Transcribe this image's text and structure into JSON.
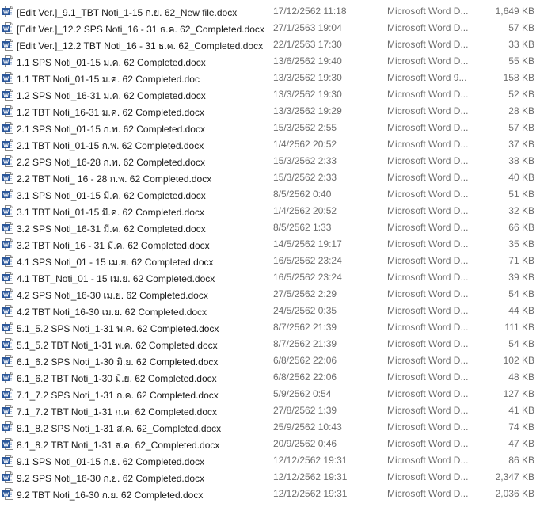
{
  "files": [
    {
      "name": "[Edit Ver.]_9.1_TBT Noti_1-15 ก.ย. 62_New file.docx",
      "date": "17/12/2562 11:18",
      "type": "Microsoft Word D...",
      "size": "1,649 KB",
      "icon": "word-document-icon"
    },
    {
      "name": "[Edit Ver.]_12.2 SPS Noti_16 - 31 ธ.ค. 62_Completed.docx",
      "date": "27/1/2563 19:04",
      "type": "Microsoft Word D...",
      "size": "57 KB",
      "icon": "word-document-icon"
    },
    {
      "name": "[Edit Ver.]_12.2 TBT Noti_16 - 31 ธ.ค. 62_Completed.docx",
      "date": "22/1/2563 17:30",
      "type": "Microsoft Word D...",
      "size": "33 KB",
      "icon": "word-document-icon"
    },
    {
      "name": "1.1 SPS Noti_01-15 ม.ค. 62 Completed.docx",
      "date": "13/6/2562 19:40",
      "type": "Microsoft Word D...",
      "size": "55 KB",
      "icon": "word-document-icon"
    },
    {
      "name": "1.1 TBT Noti_01-15 ม.ค. 62 Completed.doc",
      "date": "13/3/2562 19:30",
      "type": "Microsoft Word 9...",
      "size": "158 KB",
      "icon": "word-document-icon"
    },
    {
      "name": "1.2 SPS Noti_16-31 ม.ค. 62 Completed.docx",
      "date": "13/3/2562 19:30",
      "type": "Microsoft Word D...",
      "size": "52 KB",
      "icon": "word-document-icon"
    },
    {
      "name": "1.2 TBT Noti_16-31 ม.ค. 62 Completed.docx",
      "date": "13/3/2562 19:29",
      "type": "Microsoft Word D...",
      "size": "28 KB",
      "icon": "word-document-icon"
    },
    {
      "name": "2.1 SPS Noti_01-15 ก.พ. 62 Completed.docx",
      "date": "15/3/2562 2:55",
      "type": "Microsoft Word D...",
      "size": "57 KB",
      "icon": "word-document-icon"
    },
    {
      "name": "2.1 TBT Noti_01-15 ก.พ. 62 Completed.docx",
      "date": "1/4/2562 20:52",
      "type": "Microsoft Word D...",
      "size": "37 KB",
      "icon": "word-document-icon"
    },
    {
      "name": "2.2 SPS Noti_16-28 ก.พ. 62 Completed.docx",
      "date": "15/3/2562 2:33",
      "type": "Microsoft Word D...",
      "size": "38 KB",
      "icon": "word-document-icon"
    },
    {
      "name": "2.2 TBT Noti_ 16 - 28 ก.พ. 62 Completed.docx",
      "date": "15/3/2562 2:33",
      "type": "Microsoft Word D...",
      "size": "40 KB",
      "icon": "word-document-icon"
    },
    {
      "name": "3.1 SPS Noti_01-15 มี.ค. 62 Completed.docx",
      "date": "8/5/2562 0:40",
      "type": "Microsoft Word D...",
      "size": "51 KB",
      "icon": "word-document-icon"
    },
    {
      "name": "3.1 TBT Noti_01-15 มี.ค. 62 Completed.docx",
      "date": "1/4/2562 20:52",
      "type": "Microsoft Word D...",
      "size": "32 KB",
      "icon": "word-document-icon"
    },
    {
      "name": "3.2 SPS Noti_16-31 มี.ค. 62 Completed.docx",
      "date": "8/5/2562 1:33",
      "type": "Microsoft Word D...",
      "size": "66 KB",
      "icon": "word-document-icon"
    },
    {
      "name": "3.2 TBT Noti_16 - 31 มี.ค. 62 Completed.docx",
      "date": "14/5/2562 19:17",
      "type": "Microsoft Word D...",
      "size": "35 KB",
      "icon": "word-document-icon"
    },
    {
      "name": "4.1 SPS Noti_01 - 15 เม.ย. 62 Completed.docx",
      "date": "16/5/2562 23:24",
      "type": "Microsoft Word D...",
      "size": "71 KB",
      "icon": "word-document-icon"
    },
    {
      "name": "4.1 TBT_Noti_01 - 15 เม.ย. 62 Completed.docx",
      "date": "16/5/2562 23:24",
      "type": "Microsoft Word D...",
      "size": "39 KB",
      "icon": "word-document-icon"
    },
    {
      "name": "4.2 SPS Noti_16-30 เม.ย. 62 Completed.docx",
      "date": "27/5/2562 2:29",
      "type": "Microsoft Word D...",
      "size": "54 KB",
      "icon": "word-document-icon"
    },
    {
      "name": "4.2 TBT Noti_16-30  เม.ย. 62 Completed.docx",
      "date": "24/5/2562 0:35",
      "type": "Microsoft Word D...",
      "size": "44 KB",
      "icon": "word-document-icon"
    },
    {
      "name": "5.1_5.2 SPS Noti_1-31 พ.ค. 62 Completed.docx",
      "date": "8/7/2562 21:39",
      "type": "Microsoft Word D...",
      "size": "111 KB",
      "icon": "word-document-icon"
    },
    {
      "name": "5.1_5.2 TBT Noti_1-31 พ.ค. 62 Completed.docx",
      "date": "8/7/2562 21:39",
      "type": "Microsoft Word D...",
      "size": "54 KB",
      "icon": "word-document-icon"
    },
    {
      "name": "6.1_6.2 SPS Noti_1-30 มิ.ย. 62 Completed.docx",
      "date": "6/8/2562 22:06",
      "type": "Microsoft Word D...",
      "size": "102 KB",
      "icon": "word-document-icon"
    },
    {
      "name": "6.1_6.2 TBT Noti_1-30 มิ.ย. 62 Completed.docx",
      "date": "6/8/2562 22:06",
      "type": "Microsoft Word D...",
      "size": "48 KB",
      "icon": "word-document-icon"
    },
    {
      "name": "7.1_7.2 SPS Noti_1-31 ก.ค. 62 Completed.docx",
      "date": "5/9/2562 0:54",
      "type": "Microsoft Word D...",
      "size": "127 KB",
      "icon": "word-document-icon"
    },
    {
      "name": "7.1_7.2 TBT Noti_1-31 ก.ค. 62 Completed.docx",
      "date": "27/8/2562 1:39",
      "type": "Microsoft Word D...",
      "size": "41 KB",
      "icon": "word-document-icon"
    },
    {
      "name": "8.1_8.2 SPS Noti_1-31 ส.ค. 62_Completed.docx",
      "date": "25/9/2562 10:43",
      "type": "Microsoft Word D...",
      "size": "74 KB",
      "icon": "word-document-icon"
    },
    {
      "name": "8.1_8.2 TBT Noti_1-31 ส.ค. 62_Completed.docx",
      "date": "20/9/2562 0:46",
      "type": "Microsoft Word D...",
      "size": "47 KB",
      "icon": "word-document-icon"
    },
    {
      "name": "9.1 SPS Noti_01-15 ก.ย. 62 Completed.docx",
      "date": "12/12/2562 19:31",
      "type": "Microsoft Word D...",
      "size": "86 KB",
      "icon": "word-document-icon"
    },
    {
      "name": "9.2 SPS Noti_16-30 ก.ย. 62 Completed.docx",
      "date": "12/12/2562 19:31",
      "type": "Microsoft Word D...",
      "size": "2,347 KB",
      "icon": "word-document-icon"
    },
    {
      "name": "9.2 TBT Noti_16-30 ก.ย. 62 Completed.docx",
      "date": "12/12/2562 19:31",
      "type": "Microsoft Word D...",
      "size": "2,036 KB",
      "icon": "word-document-icon"
    }
  ],
  "colors": {
    "name_text": "#1a1a1a",
    "detail_text": "#6d6d6d",
    "icon_blue": "#2b579a",
    "hover_bg": "#e5f3ff"
  }
}
